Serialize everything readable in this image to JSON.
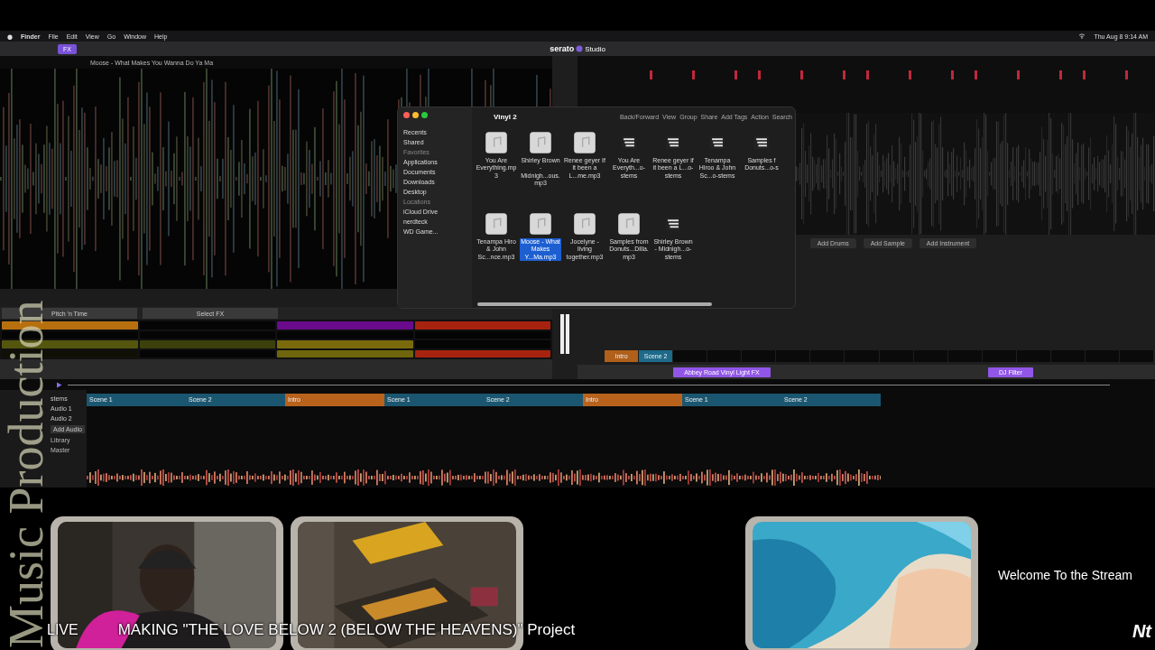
{
  "menu_bar": {
    "items": [
      "Finder",
      "File",
      "Edit",
      "View",
      "Go",
      "Window",
      "Help"
    ],
    "clock": "Thu Aug 8 9:14 AM"
  },
  "toolbar": {
    "logo": "serato",
    "logo_suffix": "Studio",
    "buttons": [
      {
        "label": "FX",
        "selected": true
      }
    ]
  },
  "deck": {
    "track_title": "Moose - What Makes You Wanna Do Ya Ma",
    "pad_banks": [
      "Pitch 'n Time",
      "Select FX"
    ],
    "pads": [
      {
        "color": "#b8700f"
      },
      {
        "color": "#050505"
      },
      {
        "color": "#6a0a8c"
      },
      {
        "color": "#a8230f"
      },
      {
        "color": "#050505"
      },
      {
        "color": "#050505"
      },
      {
        "color": "#050505"
      },
      {
        "color": "#050505"
      },
      {
        "color": "#55560e"
      },
      {
        "color": "#3c400b"
      },
      {
        "color": "#7a6a0c"
      },
      {
        "color": "#050505"
      },
      {
        "color": "#101006"
      },
      {
        "color": "#050505"
      },
      {
        "color": "#6f650c"
      },
      {
        "color": "#a8230f"
      }
    ]
  },
  "finder": {
    "title": "Vinyl 2",
    "toolbar": [
      "Back/Forward",
      "View",
      "Group",
      "Share",
      "Add Tags",
      "Action",
      "Search"
    ],
    "sidebar": [
      {
        "kind": "item",
        "label": "Recents"
      },
      {
        "kind": "item",
        "label": "Shared"
      },
      {
        "kind": "header",
        "label": "Favorites"
      },
      {
        "kind": "item",
        "label": "Applications"
      },
      {
        "kind": "item",
        "label": "Documents"
      },
      {
        "kind": "item",
        "label": "Downloads"
      },
      {
        "kind": "item",
        "label": "Desktop"
      },
      {
        "kind": "header",
        "label": "Locations"
      },
      {
        "kind": "item",
        "label": "iCloud Drive"
      },
      {
        "kind": "item",
        "label": "nerdteck"
      },
      {
        "kind": "item",
        "label": "WD Game..."
      }
    ],
    "files": [
      {
        "kind": "audio",
        "name": "You Are Everything.mp3",
        "selected": false
      },
      {
        "kind": "audio",
        "name": "Shirley Brown - Midnigh...ous.mp3",
        "selected": false
      },
      {
        "kind": "audio",
        "name": "Renee geyer If it been a L...me.mp3",
        "selected": false
      },
      {
        "kind": "stems",
        "name": "You Are Everyth...o-stems",
        "selected": false
      },
      {
        "kind": "stems",
        "name": "Renee geyer if it been a L...o-stems",
        "selected": false
      },
      {
        "kind": "stems",
        "name": "Tenampa Hiroo & John Sc...o-stems",
        "selected": false
      },
      {
        "kind": "stems",
        "name": "Samples f Donuts...o-s",
        "selected": false
      },
      {
        "kind": "audio",
        "name": "Tenampa Hiro & John Sc...nce.mp3",
        "selected": false
      },
      {
        "kind": "audio",
        "name": "Moose - What Makes Y...Ma.mp3",
        "selected": true
      },
      {
        "kind": "audio",
        "name": "Jocelyne - living together.mp3",
        "selected": false
      },
      {
        "kind": "audio",
        "name": "Samples from Donuts...Dilla.mp3",
        "selected": false
      },
      {
        "kind": "stems",
        "name": "Shirley Brown - Midnigh...o-stems",
        "selected": false
      }
    ]
  },
  "song_view": {
    "actions": [
      "Add Drums",
      "Add Sample",
      "Add Instrument"
    ],
    "scenes": [
      {
        "label": "Intro",
        "color": "#b0601a"
      },
      {
        "label": "Scene 2",
        "color": "#1d6a8a"
      }
    ],
    "fx": [
      "Abbey Road Vinyl Light FX",
      "DJ Filter"
    ]
  },
  "arrangement": {
    "tracks": [
      "stems",
      "Audio 1",
      "Audio 2"
    ],
    "add_button": "Add Audio",
    "library": "Library",
    "master": "Master",
    "clips": [
      {
        "label": "Scene 1",
        "color": "#1b5670"
      },
      {
        "label": "Scene 2",
        "color": "#1b5670"
      },
      {
        "label": "Intro",
        "color": "#b8621c"
      },
      {
        "label": "Scene 1",
        "color": "#1b5670"
      },
      {
        "label": "Scene 2",
        "color": "#1b5670"
      },
      {
        "label": "Intro",
        "color": "#b8621c"
      },
      {
        "label": "Scene 1",
        "color": "#1b5670"
      },
      {
        "label": "Scene 2",
        "color": "#1b5670"
      }
    ]
  },
  "stream": {
    "side_title": "Music Production",
    "live": "LIVE",
    "project_title": "MAKING \"THE LOVE BELOW 2 (BELOW THE HEAVENS)\" Project",
    "welcome": "Welcome To the Stream",
    "logo": "Nt"
  }
}
